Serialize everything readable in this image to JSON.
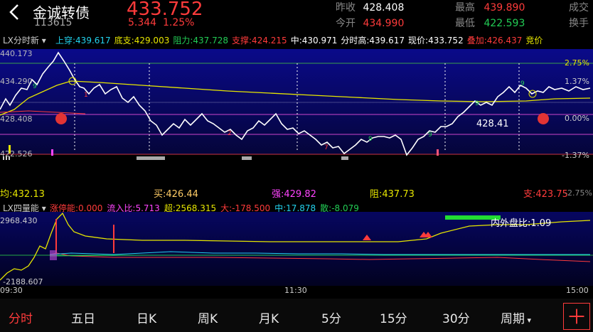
{
  "header": {
    "name": "金诚转债",
    "code": "113615",
    "price": "433.752",
    "change": "5.344",
    "change_pct": "1.25%",
    "quotes": [
      {
        "label": "昨收",
        "value": "428.408",
        "color": "#ffffff"
      },
      {
        "label": "今开",
        "value": "434.990",
        "color": "#ff3b3b"
      },
      {
        "label": "最高",
        "value": "439.890",
        "color": "#ff3b3b"
      },
      {
        "label": "最低",
        "value": "422.593",
        "color": "#22cc55"
      }
    ],
    "extra": [
      "成交",
      "换手"
    ]
  },
  "indicator1": {
    "name": "LX分时新",
    "items": [
      {
        "text": "上穿:439.617",
        "color": "#22d3ee"
      },
      {
        "text": "底支:429.003",
        "color": "#e6e600"
      },
      {
        "text": "阻力:437.728",
        "color": "#22cc55"
      },
      {
        "text": "支撑:424.215",
        "color": "#ff3b3b"
      },
      {
        "text": "中:430.971",
        "color": "#ffffff"
      },
      {
        "text": "分时高:439.617",
        "color": "#ffffff"
      },
      {
        "text": "现价:433.752",
        "color": "#ffffff"
      },
      {
        "text": "叠加:426.437",
        "color": "#ff3b3b"
      },
      {
        "text": "竞价",
        "color": "#e6e600"
      }
    ]
  },
  "main_chart": {
    "y_left": [
      "440.173",
      "434.290",
      "428.408",
      "422.526"
    ],
    "y_right": [
      "2.75%",
      "1.37%",
      "0.00%",
      "-1.37%"
    ],
    "callout": "428.41",
    "bottom_labels": [
      {
        "text": "均:432.13",
        "color": "#e6e600"
      },
      {
        "text": "买:426.44",
        "color": "#ffcc66"
      },
      {
        "text": "强:429.82",
        "color": "#ff44ff"
      },
      {
        "text": "阻:437.73",
        "color": "#e6e600"
      },
      {
        "text": "支:423.75",
        "color": "#ff3b3b"
      },
      {
        "text": "-2.75%",
        "color": "#888888"
      }
    ]
  },
  "indicator2": {
    "name": "LX四量能",
    "items": [
      {
        "text": "涨停能:0.000",
        "color": "#ff3b3b"
      },
      {
        "text": "流入比:5.713",
        "color": "#ff44ff"
      },
      {
        "text": "超:2568.315",
        "color": "#e6e600"
      },
      {
        "text": "大:-178.500",
        "color": "#ff3b3b"
      },
      {
        "text": "中:17.878",
        "color": "#22d3ee"
      },
      {
        "text": "散:-8.079",
        "color": "#22cc55"
      }
    ],
    "y_top": "2968.430",
    "y_bottom": "-2188.607",
    "ratio_label": "内外盘比:1.09"
  },
  "time_axis": [
    "09:30",
    "11:30",
    "15:00"
  ],
  "tabs": [
    "分时",
    "五日",
    "日K",
    "周K",
    "月K",
    "5分",
    "15分",
    "30分",
    "周期"
  ],
  "active_tab": 0
}
